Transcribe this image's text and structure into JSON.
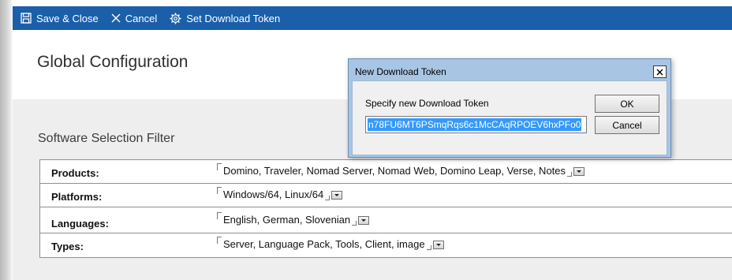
{
  "toolbar": {
    "save_close_label": "Save & Close",
    "cancel_label": "Cancel",
    "set_token_label": "Set Download Token",
    "background": "#1b5fab",
    "icons": [
      "save-icon",
      "close-x-icon",
      "gear-icon"
    ]
  },
  "page": {
    "title": "Global Configuration"
  },
  "filter": {
    "section_title": "Software Selection Filter",
    "rows": [
      {
        "label": "Products:",
        "value": "Domino, Traveler, Nomad Server, Nomad Web, Domino Leap, Verse, Notes"
      },
      {
        "label": "Platforms:",
        "value": "Windows/64, Linux/64"
      },
      {
        "label": "Languages:",
        "value": "English, German, Slovenian"
      },
      {
        "label": "Types:",
        "value": "Server, Language Pack, Tools, Client, image"
      }
    ]
  },
  "dialog": {
    "title": "New Download Token",
    "prompt": "Specify new Download Token",
    "input_value": "n78FU6MT6PSmqRqs6c1McCAqRPOEV6hxPFo0",
    "ok_label": "OK",
    "cancel_label": "Cancel",
    "close_icon": "close-icon",
    "selection_color": "#3399ff"
  }
}
